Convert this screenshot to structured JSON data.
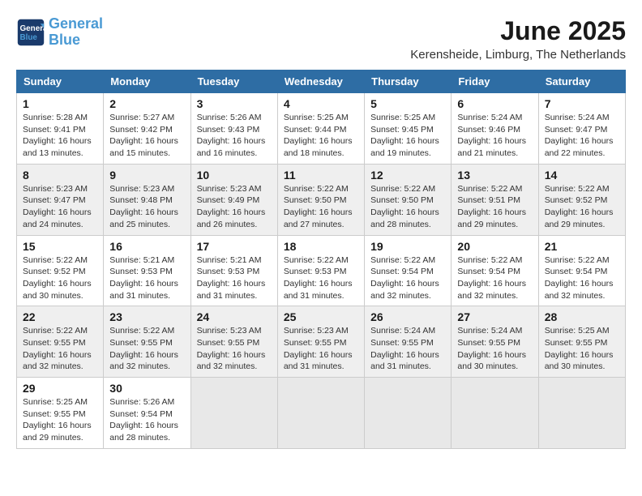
{
  "header": {
    "logo_line1": "General",
    "logo_line2": "Blue",
    "month": "June 2025",
    "location": "Kerensheide, Limburg, The Netherlands"
  },
  "weekdays": [
    "Sunday",
    "Monday",
    "Tuesday",
    "Wednesday",
    "Thursday",
    "Friday",
    "Saturday"
  ],
  "weeks": [
    [
      {
        "day": "1",
        "sunrise": "5:28 AM",
        "sunset": "9:41 PM",
        "daylight": "16 hours and 13 minutes."
      },
      {
        "day": "2",
        "sunrise": "5:27 AM",
        "sunset": "9:42 PM",
        "daylight": "16 hours and 15 minutes."
      },
      {
        "day": "3",
        "sunrise": "5:26 AM",
        "sunset": "9:43 PM",
        "daylight": "16 hours and 16 minutes."
      },
      {
        "day": "4",
        "sunrise": "5:25 AM",
        "sunset": "9:44 PM",
        "daylight": "16 hours and 18 minutes."
      },
      {
        "day": "5",
        "sunrise": "5:25 AM",
        "sunset": "9:45 PM",
        "daylight": "16 hours and 19 minutes."
      },
      {
        "day": "6",
        "sunrise": "5:24 AM",
        "sunset": "9:46 PM",
        "daylight": "16 hours and 21 minutes."
      },
      {
        "day": "7",
        "sunrise": "5:24 AM",
        "sunset": "9:47 PM",
        "daylight": "16 hours and 22 minutes."
      }
    ],
    [
      {
        "day": "8",
        "sunrise": "5:23 AM",
        "sunset": "9:47 PM",
        "daylight": "16 hours and 24 minutes."
      },
      {
        "day": "9",
        "sunrise": "5:23 AM",
        "sunset": "9:48 PM",
        "daylight": "16 hours and 25 minutes."
      },
      {
        "day": "10",
        "sunrise": "5:23 AM",
        "sunset": "9:49 PM",
        "daylight": "16 hours and 26 minutes."
      },
      {
        "day": "11",
        "sunrise": "5:22 AM",
        "sunset": "9:50 PM",
        "daylight": "16 hours and 27 minutes."
      },
      {
        "day": "12",
        "sunrise": "5:22 AM",
        "sunset": "9:50 PM",
        "daylight": "16 hours and 28 minutes."
      },
      {
        "day": "13",
        "sunrise": "5:22 AM",
        "sunset": "9:51 PM",
        "daylight": "16 hours and 29 minutes."
      },
      {
        "day": "14",
        "sunrise": "5:22 AM",
        "sunset": "9:52 PM",
        "daylight": "16 hours and 29 minutes."
      }
    ],
    [
      {
        "day": "15",
        "sunrise": "5:22 AM",
        "sunset": "9:52 PM",
        "daylight": "16 hours and 30 minutes."
      },
      {
        "day": "16",
        "sunrise": "5:21 AM",
        "sunset": "9:53 PM",
        "daylight": "16 hours and 31 minutes."
      },
      {
        "day": "17",
        "sunrise": "5:21 AM",
        "sunset": "9:53 PM",
        "daylight": "16 hours and 31 minutes."
      },
      {
        "day": "18",
        "sunrise": "5:22 AM",
        "sunset": "9:53 PM",
        "daylight": "16 hours and 31 minutes."
      },
      {
        "day": "19",
        "sunrise": "5:22 AM",
        "sunset": "9:54 PM",
        "daylight": "16 hours and 32 minutes."
      },
      {
        "day": "20",
        "sunrise": "5:22 AM",
        "sunset": "9:54 PM",
        "daylight": "16 hours and 32 minutes."
      },
      {
        "day": "21",
        "sunrise": "5:22 AM",
        "sunset": "9:54 PM",
        "daylight": "16 hours and 32 minutes."
      }
    ],
    [
      {
        "day": "22",
        "sunrise": "5:22 AM",
        "sunset": "9:55 PM",
        "daylight": "16 hours and 32 minutes."
      },
      {
        "day": "23",
        "sunrise": "5:22 AM",
        "sunset": "9:55 PM",
        "daylight": "16 hours and 32 minutes."
      },
      {
        "day": "24",
        "sunrise": "5:23 AM",
        "sunset": "9:55 PM",
        "daylight": "16 hours and 32 minutes."
      },
      {
        "day": "25",
        "sunrise": "5:23 AM",
        "sunset": "9:55 PM",
        "daylight": "16 hours and 31 minutes."
      },
      {
        "day": "26",
        "sunrise": "5:24 AM",
        "sunset": "9:55 PM",
        "daylight": "16 hours and 31 minutes."
      },
      {
        "day": "27",
        "sunrise": "5:24 AM",
        "sunset": "9:55 PM",
        "daylight": "16 hours and 30 minutes."
      },
      {
        "day": "28",
        "sunrise": "5:25 AM",
        "sunset": "9:55 PM",
        "daylight": "16 hours and 30 minutes."
      }
    ],
    [
      {
        "day": "29",
        "sunrise": "5:25 AM",
        "sunset": "9:55 PM",
        "daylight": "16 hours and 29 minutes."
      },
      {
        "day": "30",
        "sunrise": "5:26 AM",
        "sunset": "9:54 PM",
        "daylight": "16 hours and 28 minutes."
      },
      null,
      null,
      null,
      null,
      null
    ]
  ],
  "labels": {
    "sunrise": "Sunrise:",
    "sunset": "Sunset:",
    "daylight": "Daylight:"
  }
}
